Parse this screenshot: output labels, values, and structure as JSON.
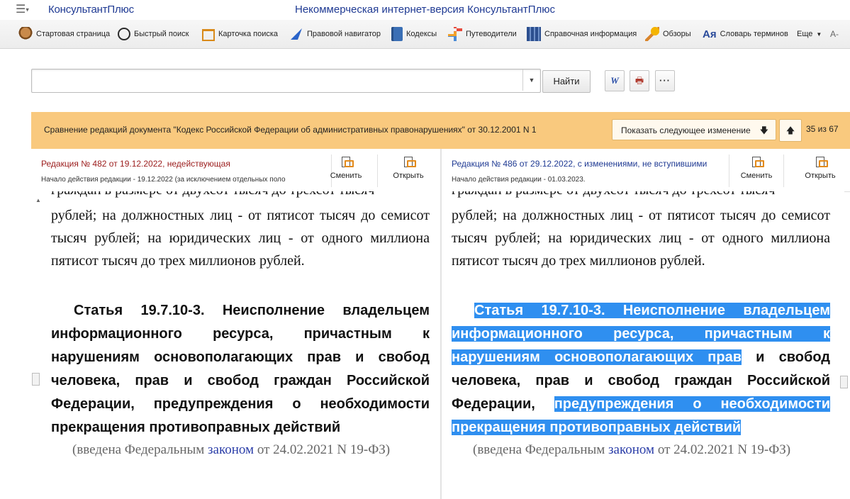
{
  "titlebar": {
    "menu_glyph": "☰",
    "brand": "КонсультантПлюс",
    "window_title": "Некоммерческая интернет-версия КонсультантПлюс"
  },
  "toolbar": {
    "items": [
      {
        "label": "Стартовая страница",
        "icon": "home-icon"
      },
      {
        "label": "Быстрый поиск",
        "icon": "search-icon"
      },
      {
        "label": "Карточка поиска",
        "icon": "search-card-icon"
      },
      {
        "label": "Правовой навигатор",
        "icon": "navigator-icon"
      },
      {
        "label": "Кодексы",
        "icon": "codes-icon"
      },
      {
        "label": "Путеводители",
        "icon": "guides-icon"
      },
      {
        "label": "Справочная информация",
        "icon": "reference-icon"
      },
      {
        "label": "Обзоры",
        "icon": "reviews-icon"
      },
      {
        "label": "Словарь терминов",
        "icon": "dictionary-icon",
        "icon_text": "Ая"
      }
    ],
    "more_label": "Еще",
    "font_size_label": "A-"
  },
  "search": {
    "value": "",
    "placeholder": "",
    "find_label": "Найти",
    "word_label": "W",
    "print_label": "🖶",
    "more_label": "···"
  },
  "comparison": {
    "text": "Сравнение редакций документа \"Кодекс Российской Федерации об административных правонарушениях\" от 30.12.2001 N 1",
    "next_change_label": "Показать следующее изменение",
    "down_arrow": "🡇",
    "up_arrow": "🡅",
    "counter": "35 из 67"
  },
  "left_edition": {
    "title": "Редакция № 482 от 19.12.2022, недействующая",
    "subtitle": "Начало действия редакции - 19.12.2022 (за исключением отдельных поло",
    "change_label": "Сменить",
    "open_label": "Открыть",
    "cut_line": "граждан в размере от двухсот тысяч до трехсот тысяч",
    "paragraph": "рублей; на должностных лиц - от пятисот тысяч до семисот тысяч рублей; на юридических лиц - от одного миллиона пятисот тысяч до трех миллионов рублей.",
    "article": "Статья 19.7.10-3. Неисполнение владельцем информационного ресурса, причастным к нарушениям основополагающих прав и свобод человека, прав и свобод граждан Российской Федерации, предупреждения о необходимости прекращения противоправных действий",
    "note_before": "(введена Федеральным ",
    "note_link": "законом",
    "note_after": " от 24.02.2021 N 19-ФЗ)"
  },
  "right_edition": {
    "title": "Редакция № 486 от 29.12.2022, с изменениями, не вступившими",
    "subtitle": "Начало действия редакции - 01.03.2023.",
    "change_label": "Сменить",
    "open_label": "Открыть",
    "cut_line": "граждан в размере от двухсот тысяч до трехсот тысяч",
    "paragraph": "рублей; на должностных лиц - от пятисот тысяч до семисот тысяч рублей; на юридических лиц - от одного миллиона пятисот тысяч до трех миллионов рублей.",
    "article_hl1": "Статья 19.7.10-3. Неисполнение владельцем информационного ресурса, причастным к нарушениям основополагающих прав",
    "article_plain": " и свобод человека, прав и свобод граждан Российской Федерации, ",
    "article_hl2": "предупреждения о необходимости прекращения противоправных действий",
    "note_before": "(введена Федеральным ",
    "note_link": "законом",
    "note_after": " от 24.02.2021 N 19-ФЗ)"
  },
  "colors": {
    "brand": "#1f3a93",
    "banner": "#f9c97e",
    "highlight": "#2f8ff0",
    "left_edition_title": "#9b1c1c"
  }
}
